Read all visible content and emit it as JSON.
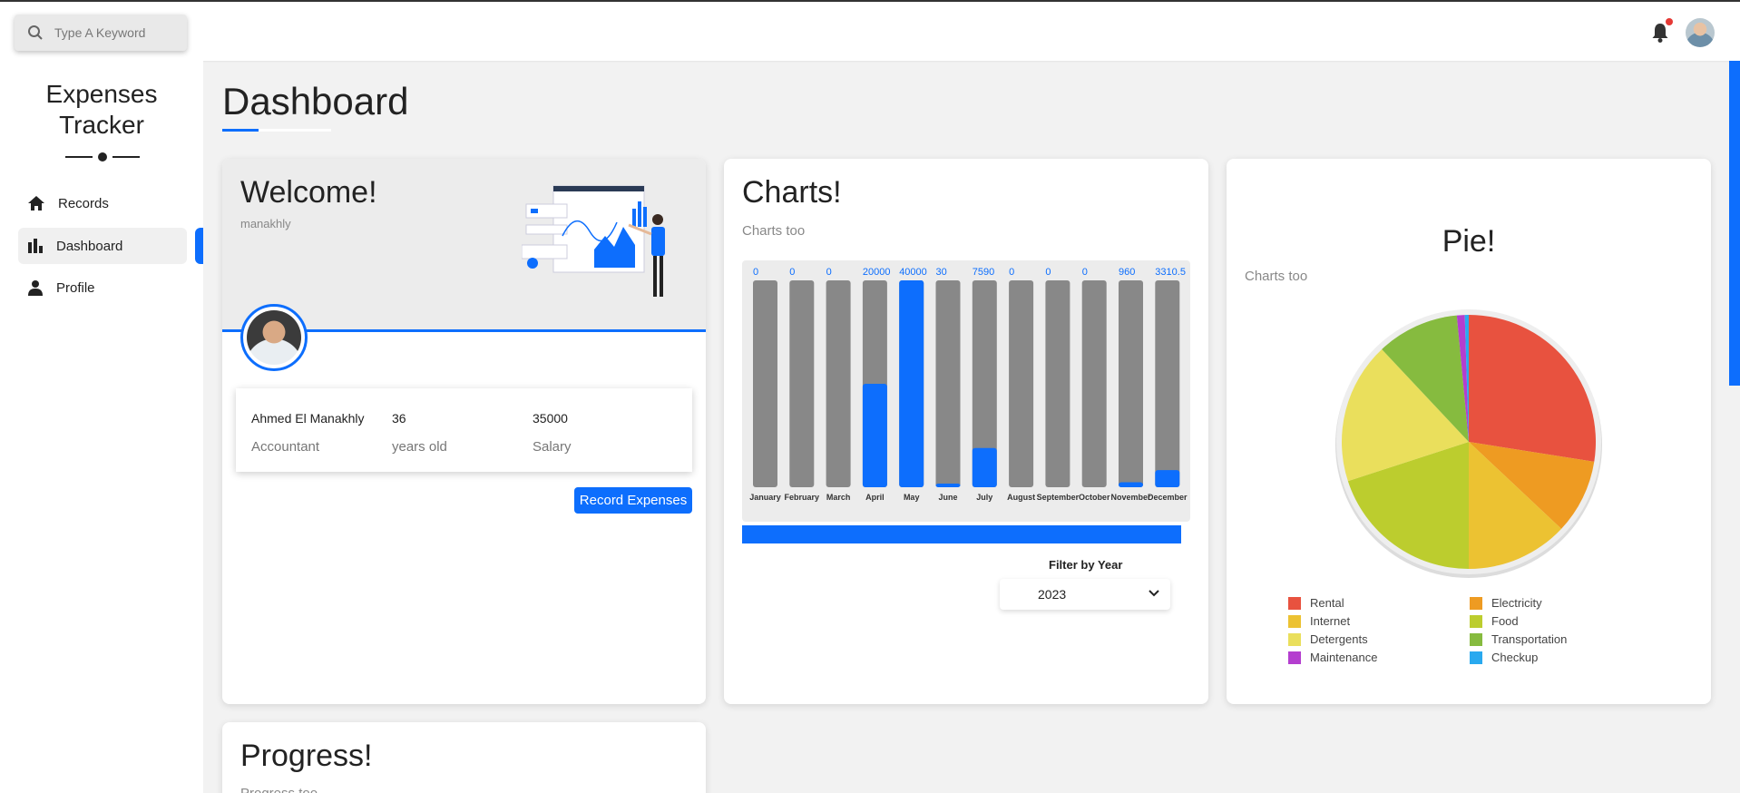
{
  "search": {
    "placeholder": "Type A Keyword"
  },
  "sidebar": {
    "brand_line1": "Expenses",
    "brand_line2": "Tracker",
    "items": [
      {
        "label": "Records",
        "icon": "home-icon"
      },
      {
        "label": "Dashboard",
        "icon": "bar-chart-icon",
        "active": true
      },
      {
        "label": "Profile",
        "icon": "user-icon"
      }
    ]
  },
  "page": {
    "title": "Dashboard"
  },
  "welcome": {
    "title": "Welcome!",
    "username": "manakhly",
    "name": "Ahmed El Manakhly",
    "job": "Accountant",
    "age": "36",
    "age_label": "years old",
    "salary": "35000",
    "salary_label": "Salary",
    "button": "Record Expenses"
  },
  "charts_card": {
    "title": "Charts!",
    "subtitle": "Charts too",
    "filter_label": "Filter by Year",
    "year": "2023"
  },
  "chart_data": {
    "type": "bar",
    "categories": [
      "January",
      "February",
      "March",
      "April",
      "May",
      "June",
      "July",
      "August",
      "September",
      "October",
      "November",
      "December"
    ],
    "values": [
      0,
      0,
      0,
      20000,
      40000,
      30,
      7590,
      0,
      0,
      0,
      960,
      3310.5
    ],
    "value_labels": [
      "0",
      "0",
      "0",
      "20000",
      "40000",
      "30",
      "7590",
      "0",
      "0",
      "0",
      "960",
      "3310.5"
    ],
    "ylim": [
      0,
      40000
    ],
    "colors": {
      "fill": "#0d6efd",
      "track": "#888888"
    }
  },
  "pie_card": {
    "title": "Pie!",
    "subtitle": "Charts too",
    "legend": [
      {
        "label": "Rental",
        "color": "#e8523f"
      },
      {
        "label": "Electricity",
        "color": "#ee9b22"
      },
      {
        "label": "Internet",
        "color": "#ecc232"
      },
      {
        "label": "Food",
        "color": "#bccd2e"
      },
      {
        "label": "Detergents",
        "color": "#eadf5c"
      },
      {
        "label": "Transportation",
        "color": "#86bb3f"
      },
      {
        "label": "Maintenance",
        "color": "#b43ecf"
      },
      {
        "label": "Checkup",
        "color": "#29a9ef"
      }
    ],
    "slices": [
      {
        "label": "Rental",
        "value": 27.5,
        "color": "#e8523f"
      },
      {
        "label": "Electricity",
        "value": 9.5,
        "color": "#ee9b22"
      },
      {
        "label": "Internet",
        "value": 13,
        "color": "#ecc232"
      },
      {
        "label": "Food",
        "value": 20,
        "color": "#bccd2e"
      },
      {
        "label": "Detergents",
        "value": 18,
        "color": "#eadf5c"
      },
      {
        "label": "Transportation",
        "value": 10.5,
        "color": "#86bb3f"
      },
      {
        "label": "Maintenance",
        "value": 1,
        "color": "#b43ecf"
      },
      {
        "label": "Checkup",
        "value": 0.5,
        "color": "#29a9ef"
      }
    ]
  },
  "progress_card": {
    "title": "Progress!",
    "subtitle": "Progress too"
  }
}
